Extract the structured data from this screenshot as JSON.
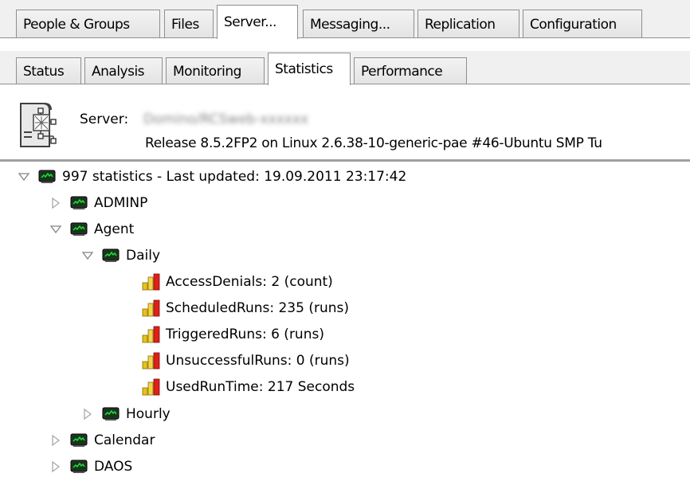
{
  "main_tabs": [
    {
      "label": "People & Groups",
      "active": false
    },
    {
      "label": "Files",
      "active": false
    },
    {
      "label": "Server...",
      "active": true
    },
    {
      "label": "Messaging...",
      "active": false
    },
    {
      "label": "Replication",
      "active": false
    },
    {
      "label": "Configuration",
      "active": false
    }
  ],
  "sub_tabs": [
    {
      "label": "Status",
      "active": false
    },
    {
      "label": "Analysis",
      "active": false
    },
    {
      "label": "Monitoring",
      "active": false
    },
    {
      "label": "Statistics",
      "active": true
    },
    {
      "label": "Performance",
      "active": false
    }
  ],
  "server": {
    "label": "Server:",
    "name": "Domino/RCSweb-xxxxxx",
    "release": "Release 8.5.2FP2 on Linux 2.6.38-10-generic-pae #46-Ubuntu SMP Tu",
    "icon": "server-icon"
  },
  "tree": {
    "root": {
      "label": "997 statistics - Last updated: 19.09.2011 23:17:42",
      "expanded": true
    },
    "adminp": {
      "label": "ADMINP",
      "expanded": false
    },
    "agent": {
      "label": "Agent",
      "expanded": true
    },
    "daily": {
      "label": "Daily",
      "expanded": true
    },
    "stats": [
      {
        "label": "AccessDenials: 2 (count)"
      },
      {
        "label": "ScheduledRuns: 235 (runs)"
      },
      {
        "label": "TriggeredRuns: 6 (runs)"
      },
      {
        "label": "UnsuccessfulRuns: 0 (runs)"
      },
      {
        "label": "UsedRunTime: 217 Seconds"
      }
    ],
    "hourly": {
      "label": "Hourly",
      "expanded": false
    },
    "calendar": {
      "label": "Calendar",
      "expanded": false
    },
    "daos": {
      "label": "DAOS",
      "expanded": false
    }
  },
  "colors": {
    "tab_border": "#8e8f8f",
    "monitor_green": "#2bd94a",
    "bar_red": "#e0201b",
    "bar_yellow": "#f1c40f"
  }
}
